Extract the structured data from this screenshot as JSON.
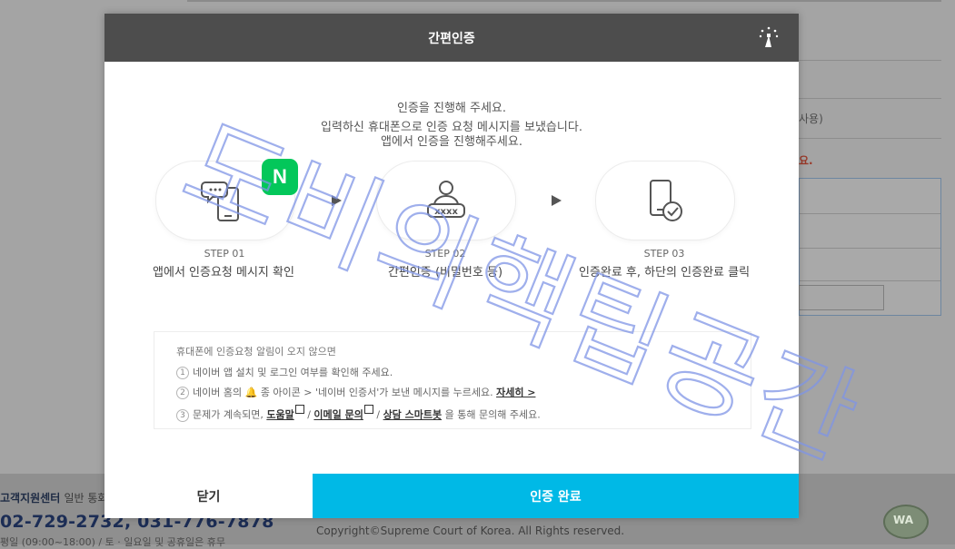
{
  "background": {
    "form_texts": [
      "사용)",
      "요."
    ],
    "support_center": "고객지원센터",
    "support_center_sub": "일반 통화",
    "phone": "02-729-2732, 031-776-7878",
    "hours": "평일 (09:00~18:00) / 토 · 일요일 및 공휴일은 휴무",
    "copyright": "Copyright©Supreme Court of Korea. All Rights reserved.",
    "logo_text": "WA"
  },
  "modal": {
    "title": "간편인증",
    "intro_line1": "인증을 진행해 주세요.",
    "intro_line2": "입력하신 휴대폰으로 인증 요청 메시지를 보냈습니다.",
    "intro_line3": "앱에서 인증을 진행해주세요.",
    "naver_badge": "N",
    "steps": [
      {
        "label": "STEP 01",
        "desc": "앱에서 인증요청 메시지 확인"
      },
      {
        "label": "STEP 02",
        "desc": "간편인증 (비밀번호 등)"
      },
      {
        "label": "STEP 03",
        "desc": "인증완료 후, 하단의 인증완료 클릭"
      }
    ],
    "notice": {
      "title": "휴대폰에 인증요청 알림이 오지 않으면",
      "item1": "네이버 앱 설치 및 로그인 여부를 확인해 주세요.",
      "item2_pre": "네이버 홈의",
      "item2_mid": "종 아이콘 > '네이버 인증서'가 보낸 메시지를 누르세요.",
      "item2_link": "자세히 >",
      "item3_pre": "문제가 계속되면,",
      "item3_link1": "도움말",
      "item3_link2": "이메일 문의",
      "item3_link3": "상담 스마트봇",
      "item3_post": "을 통해 문의해 주세요."
    },
    "close_label": "닫기",
    "done_label": "인증 완료"
  },
  "watermark_text": "도비의핵팁공간",
  "colors": {
    "primary_button": "#00b9e6",
    "header": "#4d4d4d",
    "naver": "#03c75a"
  }
}
